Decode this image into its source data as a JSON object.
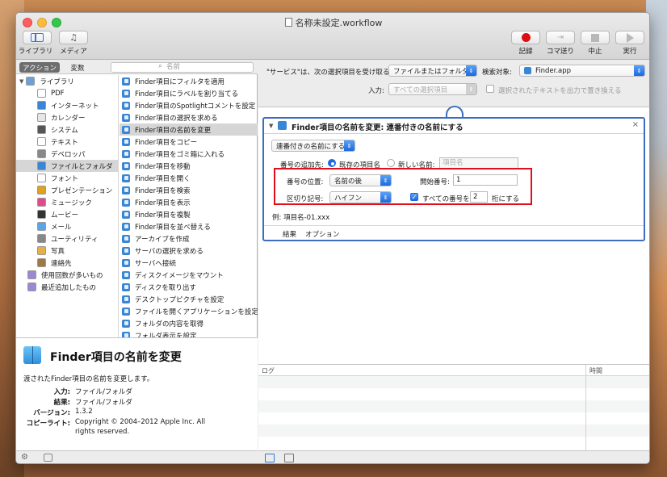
{
  "window": {
    "title": "名称未設定.workflow"
  },
  "toolbar": {
    "library_label": "ライブラリ",
    "media_label": "メディア",
    "record_label": "記録",
    "step_label": "コマ送り",
    "stop_label": "中止",
    "run_label": "実行"
  },
  "left": {
    "seg_actions": "アクション",
    "seg_variables": "変数",
    "search_placeholder": "名前",
    "categories": [
      {
        "label": "ライブラリ",
        "icon": "library-icon",
        "color": "#6d9fd9"
      },
      {
        "label": "PDF",
        "icon": "pdf-icon",
        "color": "#ffffff"
      },
      {
        "label": "インターネット",
        "icon": "globe-icon",
        "color": "#3a86d6"
      },
      {
        "label": "カレンダー",
        "icon": "calendar-icon",
        "color": "#e6e6e6"
      },
      {
        "label": "システム",
        "icon": "system-icon",
        "color": "#555555"
      },
      {
        "label": "テキスト",
        "icon": "text-icon",
        "color": "#ffffff"
      },
      {
        "label": "デベロッパ",
        "icon": "developer-icon",
        "color": "#888888"
      },
      {
        "label": "ファイルとフォルダ",
        "icon": "finder-icon",
        "color": "#3a86d6"
      },
      {
        "label": "フォント",
        "icon": "font-icon",
        "color": "#ffffff"
      },
      {
        "label": "プレゼンテーション",
        "icon": "presentation-icon",
        "color": "#e0a020"
      },
      {
        "label": "ミュージック",
        "icon": "music-icon",
        "color": "#e04a8c"
      },
      {
        "label": "ムービー",
        "icon": "movie-icon",
        "color": "#333333"
      },
      {
        "label": "メール",
        "icon": "mail-icon",
        "color": "#5ba4e6"
      },
      {
        "label": "ユーティリティ",
        "icon": "utilities-icon",
        "color": "#888888"
      },
      {
        "label": "写真",
        "icon": "photos-icon",
        "color": "#e8b040"
      },
      {
        "label": "連絡先",
        "icon": "contacts-icon",
        "color": "#a07848"
      },
      {
        "label": "使用回数が多いもの",
        "icon": "smart-folder-icon",
        "color": "#9c86d6"
      },
      {
        "label": "最近追加したもの",
        "icon": "smart-folder-icon",
        "color": "#9c86d6"
      }
    ],
    "actions": [
      "Finder項目にフィルタを適用",
      "Finder項目にラベルを割り当てる",
      "Finder項目のSpotlightコメントを設定",
      "Finder項目の選択を求める",
      "Finder項目の名前を変更",
      "Finder項目をコピー",
      "Finder項目をゴミ箱に入れる",
      "Finder項目を移動",
      "Finder項目を開く",
      "Finder項目を検索",
      "Finder項目を表示",
      "Finder項目を複製",
      "Finder項目を並べ替える",
      "アーカイブを作成",
      "サーバの選択を求める",
      "サーバへ接続",
      "ディスクイメージをマウント",
      "ディスクを取り出す",
      "デスクトップピクチャを設定",
      "ファイルを開くアプリケーションを設定",
      "フォルダの内容を取得",
      "フォルダ表示を設定"
    ],
    "description": {
      "title": "Finder項目の名前を変更",
      "text": "渡されたFinder項目の名前を変更します。",
      "input_key": "入力:",
      "input_val": "ファイル/フォルダ",
      "result_key": "結果:",
      "result_val": "ファイル/フォルダ",
      "version_key": "バージョン:",
      "version_val": "1.3.2",
      "copyright_key": "コピーライト:",
      "copyright_val1": "Copyright © 2004–2012 Apple Inc.  All",
      "copyright_val2": "rights reserved."
    }
  },
  "service": {
    "receives_label": "\"サービス\"は、次の選択項目を受け取る:",
    "receives_value": "ファイルまたはフォルダ",
    "target_label": "検索対象:",
    "target_value": "Finder.app",
    "input_label": "入力:",
    "input_value": "すべての選択項目",
    "replace_label": "選択されたテキストを出力で置き換える"
  },
  "action": {
    "title": "Finder項目の名前を変更: 連番付きの名前にする",
    "mode_value": "連番付きの名前にする",
    "add_number_label": "番号の追加先:",
    "existing_name_label": "既存の項目名",
    "new_name_label": "新しい名前:",
    "new_name_placeholder": "項目名",
    "position_label": "番号の位置:",
    "position_value": "名前の後",
    "start_label": "開始番号:",
    "start_value": "1",
    "separator_label": "区切り記号:",
    "separator_value": "ハイフン",
    "digits_check_label": "すべての番号を",
    "digits_value": "2",
    "digits_suffix": "桁にする",
    "example": "例: 項目名-01.xxx",
    "tab_results": "結果",
    "tab_options": "オプション"
  },
  "log": {
    "col_log": "ログ",
    "col_time": "時間"
  },
  "colors": {
    "accent": "#1b6ae0",
    "highlight": "#e0101a",
    "selection": "#d6d6d6"
  }
}
